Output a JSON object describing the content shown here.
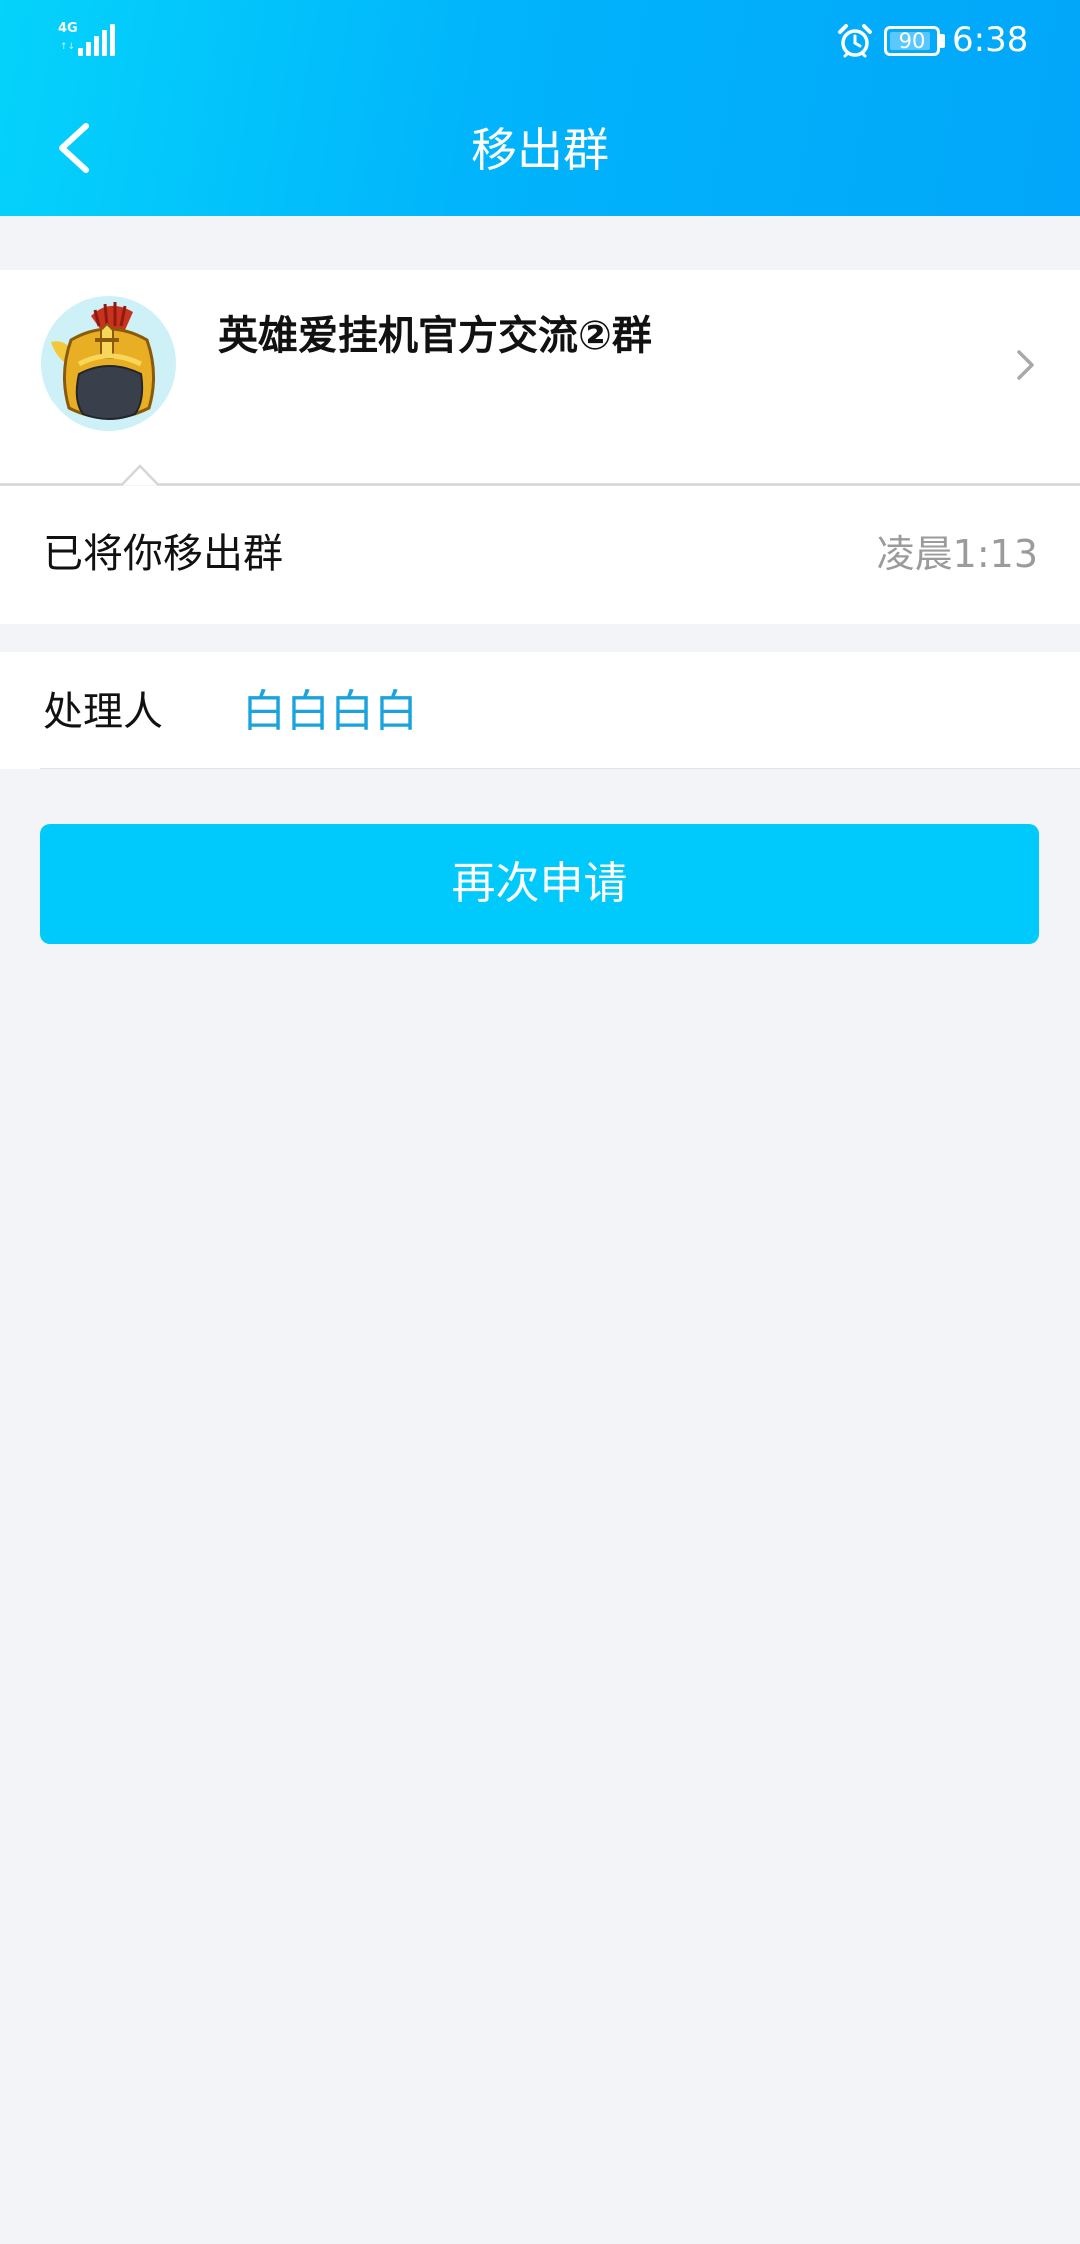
{
  "status_bar": {
    "network": "4G",
    "battery": "90",
    "time": "6:38"
  },
  "header": {
    "title": "移出群"
  },
  "group": {
    "name": "英雄爱挂机官方交流②群"
  },
  "notice": {
    "message": "已将你移出群",
    "time": "凌晨1:13"
  },
  "handler": {
    "label": "处理人",
    "name": "白白白白"
  },
  "actions": {
    "reapply_label": "再次申请"
  },
  "colors": {
    "header_gradient_start": "#04d3fb",
    "header_gradient_end": "#02a6fa",
    "accent": "#00cafc",
    "link": "#1aa3dd",
    "background": "#f3f4f8"
  }
}
